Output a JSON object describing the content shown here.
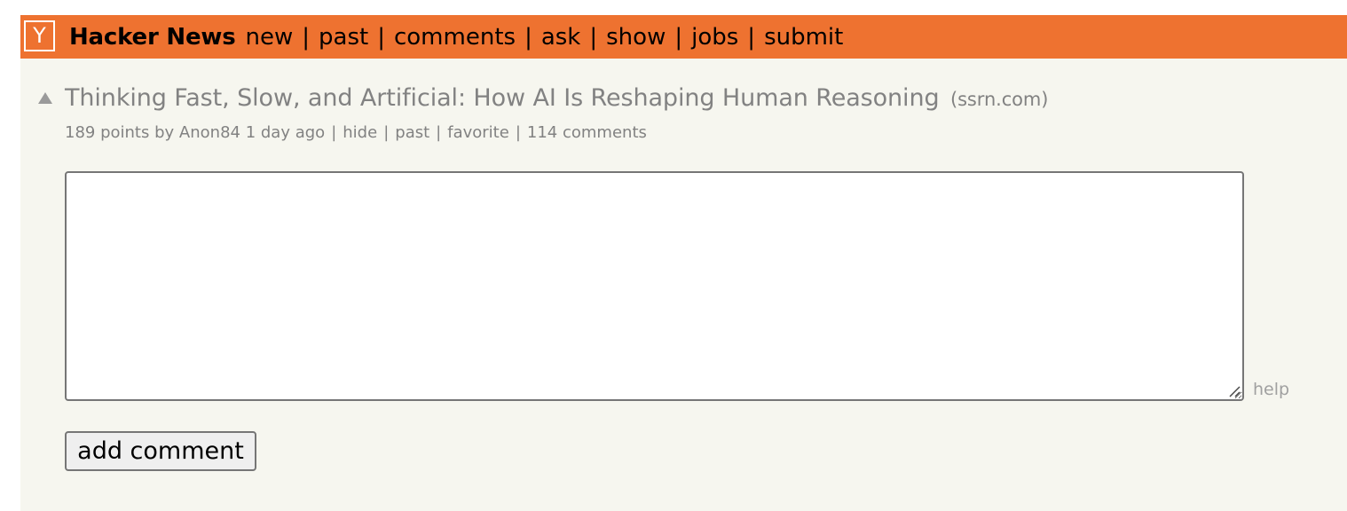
{
  "header": {
    "logo_letter": "Y",
    "site_title": "Hacker News",
    "nav": [
      "new",
      "past",
      "comments",
      "ask",
      "show",
      "jobs",
      "submit"
    ],
    "separator": "|",
    "bar_color": "#ee7230"
  },
  "story": {
    "title": "Thinking Fast, Slow, and Artificial: How AI Is Reshaping Human Reasoning",
    "site": "(ssrn.com)",
    "points_text": "189 points",
    "by_text": "by",
    "author": "Anon84",
    "age": "1 day ago",
    "actions": [
      "hide",
      "past",
      "favorite",
      "114 comments"
    ]
  },
  "comment_form": {
    "textarea_value": "",
    "help_label": "help",
    "submit_label": "add comment"
  },
  "colors": {
    "page_background": "#f6f6ef",
    "subtext": "#828282"
  }
}
